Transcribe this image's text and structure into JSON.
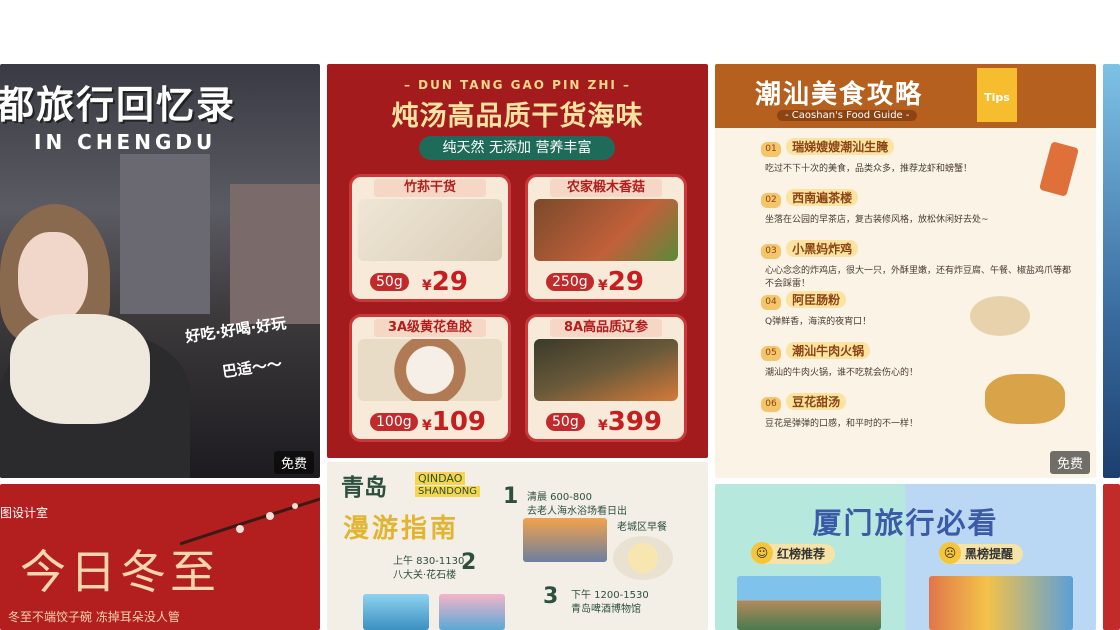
{
  "badges": {
    "free": "免费"
  },
  "card1": {
    "title": "都旅行回忆录",
    "subtitle": "IN CHENGDU",
    "slogan1": "好吃·好喝·好玩",
    "slogan2": "巴适～～"
  },
  "card2": {
    "pinyin": "– DUN TANG GAO PIN ZHI –",
    "title": "炖汤高品质干货海味",
    "ribbon": "纯天然 无添加 营养丰富",
    "products": [
      {
        "label": "竹荪干货",
        "weight": "50g",
        "currency": "¥",
        "price": "29"
      },
      {
        "label": "农家椴木香菇",
        "weight": "250g",
        "currency": "¥",
        "price": "29"
      },
      {
        "label": "3A级黄花鱼胶",
        "weight": "100g",
        "currency": "¥",
        "price": "109"
      },
      {
        "label": "8A高品质辽参",
        "weight": "50g",
        "currency": "¥",
        "price": "399"
      }
    ]
  },
  "card3": {
    "title": "潮汕美食攻略",
    "subtitle": "- Caoshan's Food Guide -",
    "tips": "Tips",
    "items": [
      {
        "num": "01",
        "name": "瑞娣嫂嫂潮汕生腌",
        "desc": "吃过不下十次的美食，品类众多，推荐龙虾和螃蟹！"
      },
      {
        "num": "02",
        "name": "西南遍茶楼",
        "desc": "坐落在公园的早茶店，复古装修风格，放松休闲好去处~"
      },
      {
        "num": "03",
        "name": "小黑妈炸鸡",
        "desc": "心心念念的炸鸡店，很大一只，外酥里嫩，还有炸豆腐、午餐、椒盐鸡爪等都不会踩雷！"
      },
      {
        "num": "04",
        "name": "阿臣肠粉",
        "desc": "Q弹鲜香，海滨的夜宵口！"
      },
      {
        "num": "05",
        "name": "潮汕牛肉火锅",
        "desc": "潮汕的牛肉火锅，谁不吃就会伤心的！"
      },
      {
        "num": "06",
        "name": "豆花甜汤",
        "desc": "豆花是弹弹的口感，和平时的不一样！"
      }
    ]
  },
  "card5": {
    "studio": "图设计室",
    "title": "今日冬至",
    "subtitle": "冬至不端饺子碗 冻掉耳朵没人管"
  },
  "card6": {
    "city": "青岛",
    "pinyin1": "QINDAO",
    "pinyin2": "SHANDONG",
    "guide": "漫游指南",
    "step1_time": "清晨 600-800",
    "step1_desc": "去老人海水浴场看日出",
    "step1_note": "老城区早餐",
    "step2_time": "上午 830-1130",
    "step2_desc": "八大关·花石楼",
    "step3_time": "下午 1200-1530",
    "step3_desc": "青岛啤酒博物馆"
  },
  "card7": {
    "title": "厦门旅行必看",
    "tag_red": "红榜推荐",
    "tag_black": "黑榜提醒"
  },
  "colors": {
    "card2_bg": "#a31b1c",
    "card3_head": "#b5601e",
    "card7_title": "#3b5aa8"
  }
}
